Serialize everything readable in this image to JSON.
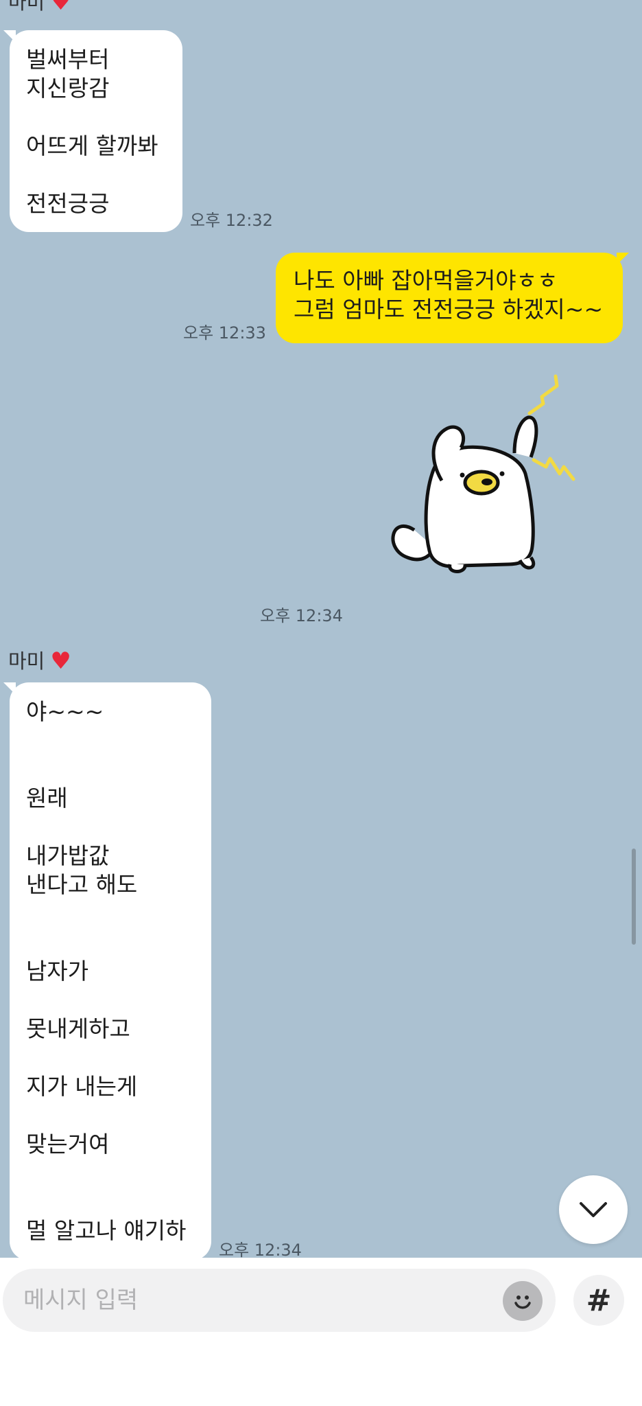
{
  "chat": {
    "messages": [
      {
        "sender": "마미",
        "lines": "벌써부터\n지신랑감\n\n어뜨게 할까봐\n\n전전긍긍",
        "time": "오후 12:32"
      },
      {
        "sender": "me",
        "lines": "나도 아빠 잡아먹을거야ㅎㅎ\n그럼 엄마도 전전긍긍 하겠지~~",
        "time": "오후 12:33"
      },
      {
        "sender": "me",
        "sticker": "startled-white-bird-sticker",
        "time": "오후 12:34"
      },
      {
        "sender": "마미",
        "lines": "야~~~\n\n\n원래\n\n내가밥값\n낸다고 해도\n\n\n남자가\n\n못내게하고\n\n지가 내는게\n\n맞는거여\n\n\n멀 알고나 얘기하",
        "time": "오후 12:34"
      }
    ],
    "top_partial_sender": "마미",
    "sender_name": "마미",
    "heart_icon": "red-heart-emoji"
  },
  "input": {
    "placeholder": "메시지 입력",
    "emoji_icon": "smiley-icon",
    "hash_label": "#"
  },
  "controls": {
    "scroll_down_icon": "chevron-down-icon"
  },
  "colors": {
    "background": "#abc1d1",
    "sent_bubble": "#fee500",
    "received_bubble": "#ffffff"
  }
}
